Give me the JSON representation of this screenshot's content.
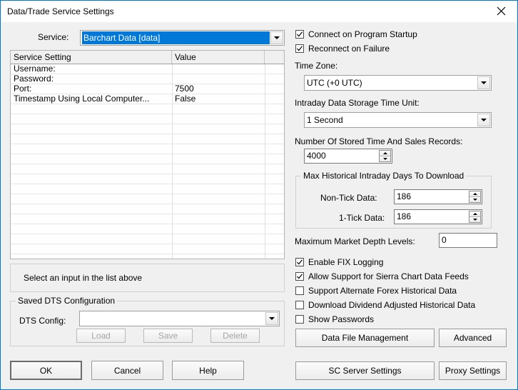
{
  "window": {
    "title": "Data/Trade Service Settings",
    "close_icon": "close-icon",
    "accent_color": "#0078d7"
  },
  "service": {
    "label": "Service:",
    "selected": "Barchart Data   [data]",
    "highlight_color": "#0078d7"
  },
  "settings_grid": {
    "columns": [
      "Service Setting",
      "Value"
    ],
    "rows": [
      {
        "setting": "Username:",
        "value": ""
      },
      {
        "setting": "Password:",
        "value": ""
      },
      {
        "setting": "Port:",
        "value": "7500"
      },
      {
        "setting": "Timestamp Using Local Computer...",
        "value": "False"
      }
    ]
  },
  "info": {
    "message": "Select an input in the list above"
  },
  "dts": {
    "group_title": "Saved DTS Configuration",
    "config_label": "DTS Config:",
    "config_value": "",
    "load_label": "Load",
    "save_label": "Save",
    "delete_label": "Delete"
  },
  "dialog_buttons": {
    "ok": "OK",
    "cancel": "Cancel",
    "help": "Help"
  },
  "right": {
    "connect_on_startup": {
      "label": "Connect on Program Startup",
      "checked": true
    },
    "reconnect_on_failure": {
      "label": "Reconnect on Failure",
      "checked": true
    },
    "time_zone": {
      "label": "Time Zone:",
      "value": "UTC (+0 UTC)"
    },
    "storage_unit": {
      "label": "Intraday Data Storage Time Unit:",
      "value": "1 Second"
    },
    "stored_records": {
      "label": "Number Of Stored Time And Sales Records:",
      "value": "4000"
    },
    "max_hist": {
      "group_title": "Max Historical Intraday Days To Download",
      "non_tick_label": "Non-Tick Data:",
      "non_tick_value": "186",
      "one_tick_label": "1-Tick Data:",
      "one_tick_value": "186"
    },
    "depth_levels": {
      "label": "Maximum Market Depth Levels:",
      "value": "0"
    },
    "checkboxes": [
      {
        "label": "Enable FIX Logging",
        "checked": true
      },
      {
        "label": "Allow Support for Sierra Chart Data Feeds",
        "checked": true
      },
      {
        "label": "Support Alternate Forex Historical Data",
        "checked": false
      },
      {
        "label": "Download Dividend Adjusted Historical Data",
        "checked": false
      },
      {
        "label": "Show Passwords",
        "checked": false
      }
    ],
    "buttons": {
      "data_file_management": "Data File Management",
      "advanced": "Advanced",
      "sc_server_settings": "SC Server Settings",
      "proxy_settings": "Proxy Settings"
    }
  }
}
